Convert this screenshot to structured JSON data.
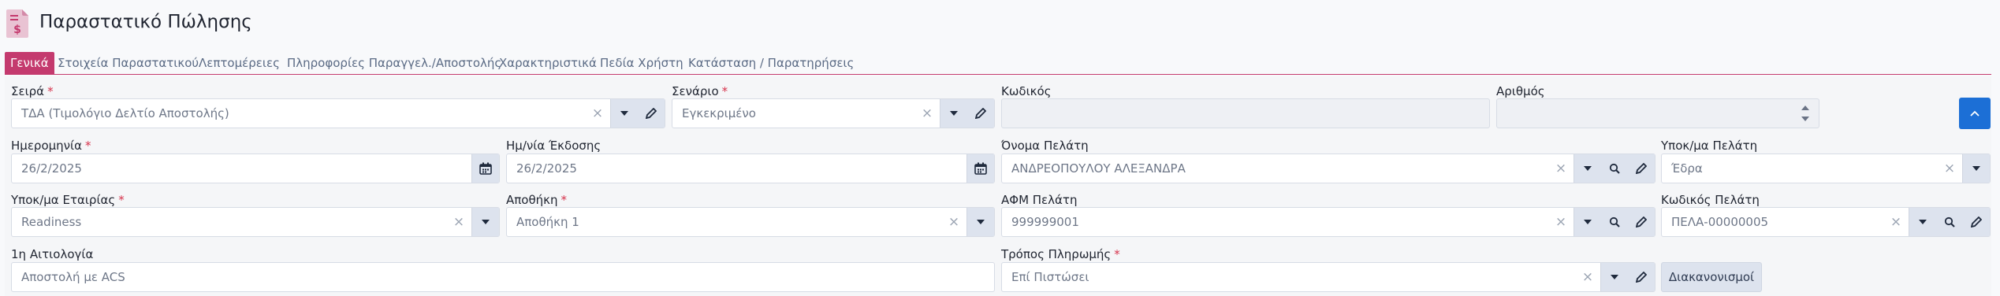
{
  "header": {
    "title": "Παραστατικό Πώλησης"
  },
  "tabs": [
    {
      "label": "Γενικά",
      "active": true
    },
    {
      "label": "Στοιχεία Παραστατικού"
    },
    {
      "label": "Λεπτομέρειες"
    },
    {
      "label": "Πληροφορίες Παραγγελ./Αποστολής"
    },
    {
      "label": "Χαρακτηριστικά"
    },
    {
      "label": "Πεδία Χρήστη"
    },
    {
      "label": "Κατάσταση / Παρατηρήσεις"
    }
  ],
  "form": {
    "seira": {
      "label": "Σειρά",
      "value": "ΤΔΑ (Τιμολόγιο Δελτίο Αποστολής)"
    },
    "senario": {
      "label": "Σενάριο",
      "value": "Εγκεκριμένο"
    },
    "kodikos": {
      "label": "Κωδικός",
      "value": ""
    },
    "arithmos": {
      "label": "Αριθμός",
      "value": ""
    },
    "imerominia": {
      "label": "Ημερομηνία",
      "value": "26/2/2025"
    },
    "imnia_ekdosis": {
      "label": "Ημ/νία Έκδοσης",
      "value": "26/2/2025"
    },
    "onoma_pelati": {
      "label": "Όνομα Πελάτη",
      "value": "ΑΝΔΡΕΟΠΟΥΛΟΥ ΑΛΕΞΑΝΔΡΑ"
    },
    "ypok_pelati": {
      "label": "Υποκ/μα Πελάτη",
      "value": "Έδρα"
    },
    "ypok_etairias": {
      "label": "Υποκ/μα Εταιρίας",
      "value": "Readiness"
    },
    "apothiki": {
      "label": "Αποθήκη",
      "value": "Αποθήκη 1"
    },
    "afm_pelati": {
      "label": "ΑΦΜ Πελάτη",
      "value": "999999001"
    },
    "kodikos_pelati": {
      "label": "Κωδικός Πελάτη",
      "value": "ΠΕΛΑ-00000005"
    },
    "aitiologia": {
      "label": "1η Αιτιολογία",
      "value": "Αποστολή με ACS"
    },
    "tropos_pliromis": {
      "label": "Τρόπος Πληρωμής",
      "value": "Επί Πιστώσει"
    },
    "diakanonismoi_label": "Διακανονισμοί",
    "required_mark": "*"
  },
  "colors": {
    "accent": "#c43a6e",
    "primary": "#1c6fd6",
    "required": "#d6334c"
  }
}
